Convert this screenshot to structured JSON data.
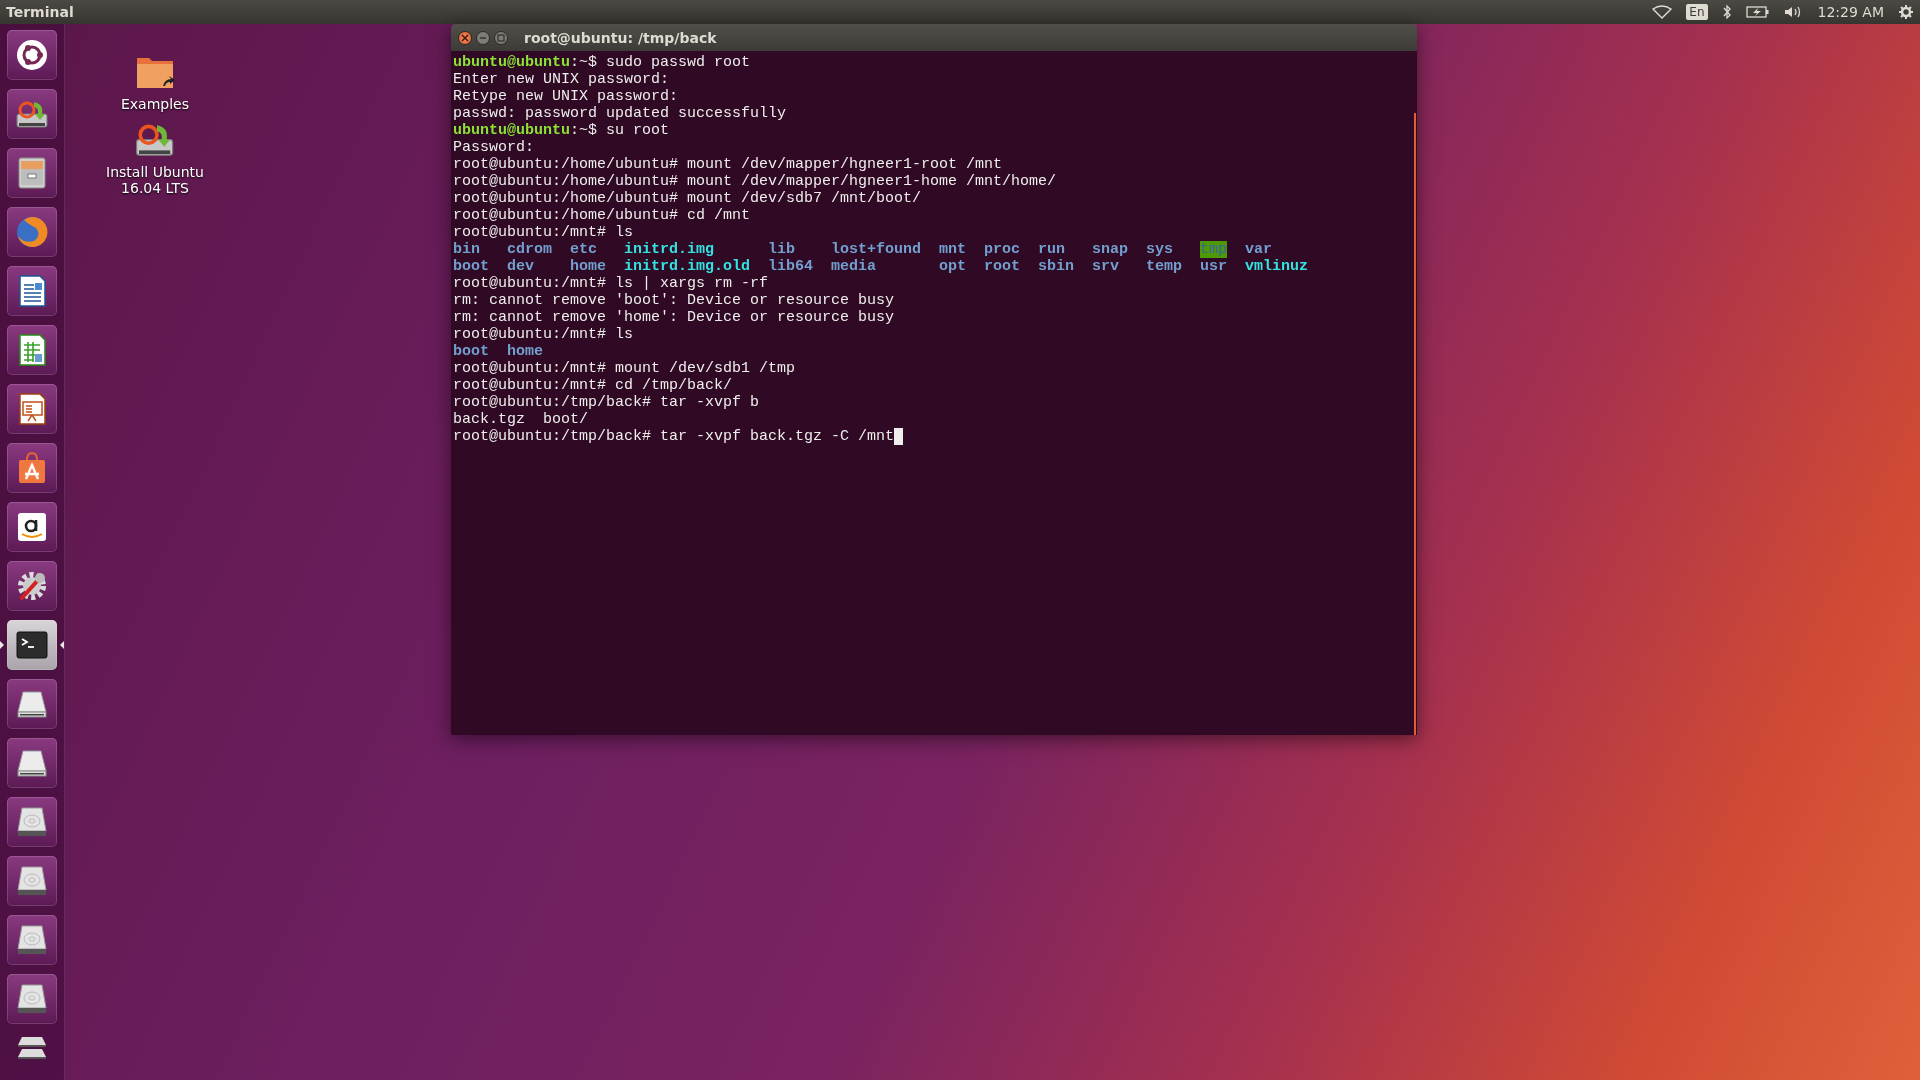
{
  "top_panel": {
    "app_name": "Terminal",
    "keyboard_layout": "En",
    "clock": "12:29 AM"
  },
  "launcher": {
    "items": [
      {
        "kind": "dash",
        "active": false
      },
      {
        "kind": "installer",
        "active": false
      },
      {
        "kind": "files",
        "active": false
      },
      {
        "kind": "browser",
        "active": false
      },
      {
        "kind": "writer",
        "active": false
      },
      {
        "kind": "calc",
        "active": false
      },
      {
        "kind": "impress",
        "active": false
      },
      {
        "kind": "store",
        "active": false
      },
      {
        "kind": "amazon",
        "active": false
      },
      {
        "kind": "settings",
        "active": false
      },
      {
        "kind": "terminal",
        "active": true
      },
      {
        "kind": "removable-drive",
        "active": false
      },
      {
        "kind": "removable-drive",
        "active": false
      },
      {
        "kind": "hard-drive",
        "active": false
      },
      {
        "kind": "hard-drive",
        "active": false
      },
      {
        "kind": "hard-drive",
        "active": false
      },
      {
        "kind": "hard-drive",
        "active": false
      },
      {
        "kind": "collapsed-drives",
        "active": false
      }
    ]
  },
  "desktop_icons": [
    {
      "kind": "folder",
      "label": "Examples"
    },
    {
      "kind": "installer",
      "label": "Install Ubuntu 16.04 LTS"
    }
  ],
  "terminal": {
    "title": "root@ubuntu: /tmp/back",
    "lines": [
      {
        "kind": "line",
        "segments": [
          {
            "text": "ubuntu@ubuntu",
            "kind": "user"
          },
          {
            "text": ":~$ sudo passwd root",
            "kind": "plain"
          }
        ]
      },
      {
        "kind": "line",
        "segments": [
          {
            "text": "Enter new UNIX password:",
            "kind": "plain"
          }
        ]
      },
      {
        "kind": "line",
        "segments": [
          {
            "text": "Retype new UNIX password:",
            "kind": "plain"
          }
        ]
      },
      {
        "kind": "line",
        "segments": [
          {
            "text": "passwd: password updated successfully",
            "kind": "plain"
          }
        ]
      },
      {
        "kind": "line",
        "segments": [
          {
            "text": "ubuntu@ubuntu",
            "kind": "user"
          },
          {
            "text": ":~$ su root",
            "kind": "plain"
          }
        ]
      },
      {
        "kind": "line",
        "segments": [
          {
            "text": "Password:",
            "kind": "plain"
          }
        ]
      },
      {
        "kind": "line",
        "segments": [
          {
            "text": "root@ubuntu:/home/ubuntu# mount /dev/mapper/hgneer1-root /mnt",
            "kind": "plain"
          }
        ]
      },
      {
        "kind": "line",
        "segments": [
          {
            "text": "root@ubuntu:/home/ubuntu# mount /dev/mapper/hgneer1-home /mnt/home/",
            "kind": "plain"
          }
        ]
      },
      {
        "kind": "line",
        "segments": [
          {
            "text": "root@ubuntu:/home/ubuntu# mount /dev/sdb7 /mnt/boot/",
            "kind": "plain"
          }
        ]
      },
      {
        "kind": "line",
        "segments": [
          {
            "text": "root@ubuntu:/home/ubuntu# cd /mnt",
            "kind": "plain"
          }
        ]
      },
      {
        "kind": "line",
        "segments": [
          {
            "text": "root@ubuntu:/mnt# ls",
            "kind": "plain"
          }
        ]
      },
      {
        "kind": "listing",
        "rows": [
          [
            {
              "text": "bin",
              "kind": "dir"
            },
            {
              "text": "cdrom",
              "kind": "dir"
            },
            {
              "text": "etc",
              "kind": "dir"
            },
            {
              "text": "initrd.img",
              "kind": "link"
            },
            {
              "text": "lib",
              "kind": "dir"
            },
            {
              "text": "lost+found",
              "kind": "dir"
            },
            {
              "text": "mnt",
              "kind": "dir"
            },
            {
              "text": "proc",
              "kind": "dir"
            },
            {
              "text": "run",
              "kind": "dir"
            },
            {
              "text": "snap",
              "kind": "dir"
            },
            {
              "text": "sys",
              "kind": "dir"
            },
            {
              "text": "tmp",
              "kind": "sticky"
            },
            {
              "text": "var",
              "kind": "dir"
            }
          ],
          [
            {
              "text": "boot",
              "kind": "dir"
            },
            {
              "text": "dev",
              "kind": "dir"
            },
            {
              "text": "home",
              "kind": "dir"
            },
            {
              "text": "initrd.img.old",
              "kind": "link"
            },
            {
              "text": "lib64",
              "kind": "dir"
            },
            {
              "text": "media",
              "kind": "dir"
            },
            {
              "text": "opt",
              "kind": "dir"
            },
            {
              "text": "root",
              "kind": "dir"
            },
            {
              "text": "sbin",
              "kind": "dir"
            },
            {
              "text": "srv",
              "kind": "dir"
            },
            {
              "text": "temp",
              "kind": "dir"
            },
            {
              "text": "usr",
              "kind": "dir"
            },
            {
              "text": "vmlinuz",
              "kind": "link"
            }
          ]
        ]
      },
      {
        "kind": "line",
        "segments": [
          {
            "text": "root@ubuntu:/mnt# ls | xargs rm -rf",
            "kind": "plain"
          }
        ]
      },
      {
        "kind": "line",
        "segments": [
          {
            "text": "rm: cannot remove 'boot': Device or resource busy",
            "kind": "plain"
          }
        ]
      },
      {
        "kind": "line",
        "segments": [
          {
            "text": "rm: cannot remove 'home': Device or resource busy",
            "kind": "plain"
          }
        ]
      },
      {
        "kind": "line",
        "segments": [
          {
            "text": "root@ubuntu:/mnt# ls",
            "kind": "plain"
          }
        ]
      },
      {
        "kind": "listing",
        "rows": [
          [
            {
              "text": "boot",
              "kind": "dir"
            },
            {
              "text": "home",
              "kind": "dir"
            }
          ]
        ]
      },
      {
        "kind": "line",
        "segments": [
          {
            "text": "root@ubuntu:/mnt# mount /dev/sdb1 /tmp",
            "kind": "plain"
          }
        ]
      },
      {
        "kind": "line",
        "segments": [
          {
            "text": "root@ubuntu:/mnt# cd /tmp/back/",
            "kind": "plain"
          }
        ]
      },
      {
        "kind": "line",
        "segments": [
          {
            "text": "root@ubuntu:/tmp/back# tar -xvpf b",
            "kind": "plain"
          }
        ]
      },
      {
        "kind": "line",
        "segments": [
          {
            "text": "back.tgz  boot/",
            "kind": "plain"
          }
        ]
      },
      {
        "kind": "line",
        "cursor": true,
        "segments": [
          {
            "text": "root@ubuntu:/tmp/back# tar -xvpf back.tgz -C /mnt",
            "kind": "plain"
          }
        ]
      }
    ]
  }
}
